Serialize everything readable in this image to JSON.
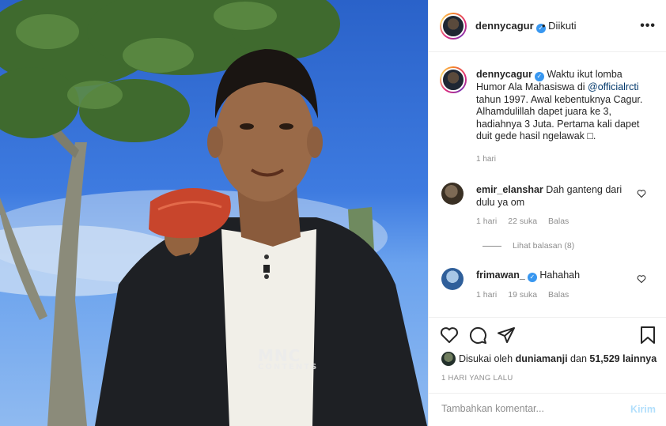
{
  "post": {
    "username": "dennycagur",
    "follow_status": "• Diikuti",
    "more_label": "•••",
    "caption": {
      "username": "dennycagur",
      "text_before": "Waktu ikut lomba Humor Ala Mahasiswa di ",
      "mention": "@officialrcti",
      "text_after": " tahun 1997. Awal kebentuknya Cagur. Alhamdulillah dapet juara ke 3, hadiahnya 3 Juta. Pertama kali dapet duit gede hasil ngelawak □.",
      "time": "1 hari"
    },
    "comments": [
      {
        "username": "emir_elanshar",
        "verified": false,
        "text": "Dah ganteng dari dulu ya om",
        "time": "1 hari",
        "likes": "22 suka",
        "reply": "Balas",
        "view_replies": "Lihat balasan (8)"
      },
      {
        "username": "frimawan_",
        "verified": true,
        "text": "Hahahah",
        "time": "1 hari",
        "likes": "19 suka",
        "reply": "Balas"
      }
    ],
    "liked_by": {
      "prefix": "Disukai oleh",
      "user": "duniamanji",
      "joiner": "dan",
      "count": "51,529 lainnya"
    },
    "posted_ago": "1 HARI YANG LALU",
    "comment_input": {
      "placeholder": "Tambahkan komentar...",
      "send_label": "Kirim"
    },
    "photo": {
      "watermark_line1": "MNC",
      "watermark_line2": "CONTENTS"
    }
  },
  "icons": {
    "like": "heart-icon",
    "comment": "comment-icon",
    "share": "paper-plane-icon",
    "save": "bookmark-icon",
    "verified": "verified-badge-icon",
    "more": "more-options-icon"
  },
  "colors": {
    "verified": "#3897f0",
    "mention": "#00376b",
    "muted": "#8e8e8e",
    "send_disabled": "#b2dffc",
    "border": "#efefef"
  }
}
